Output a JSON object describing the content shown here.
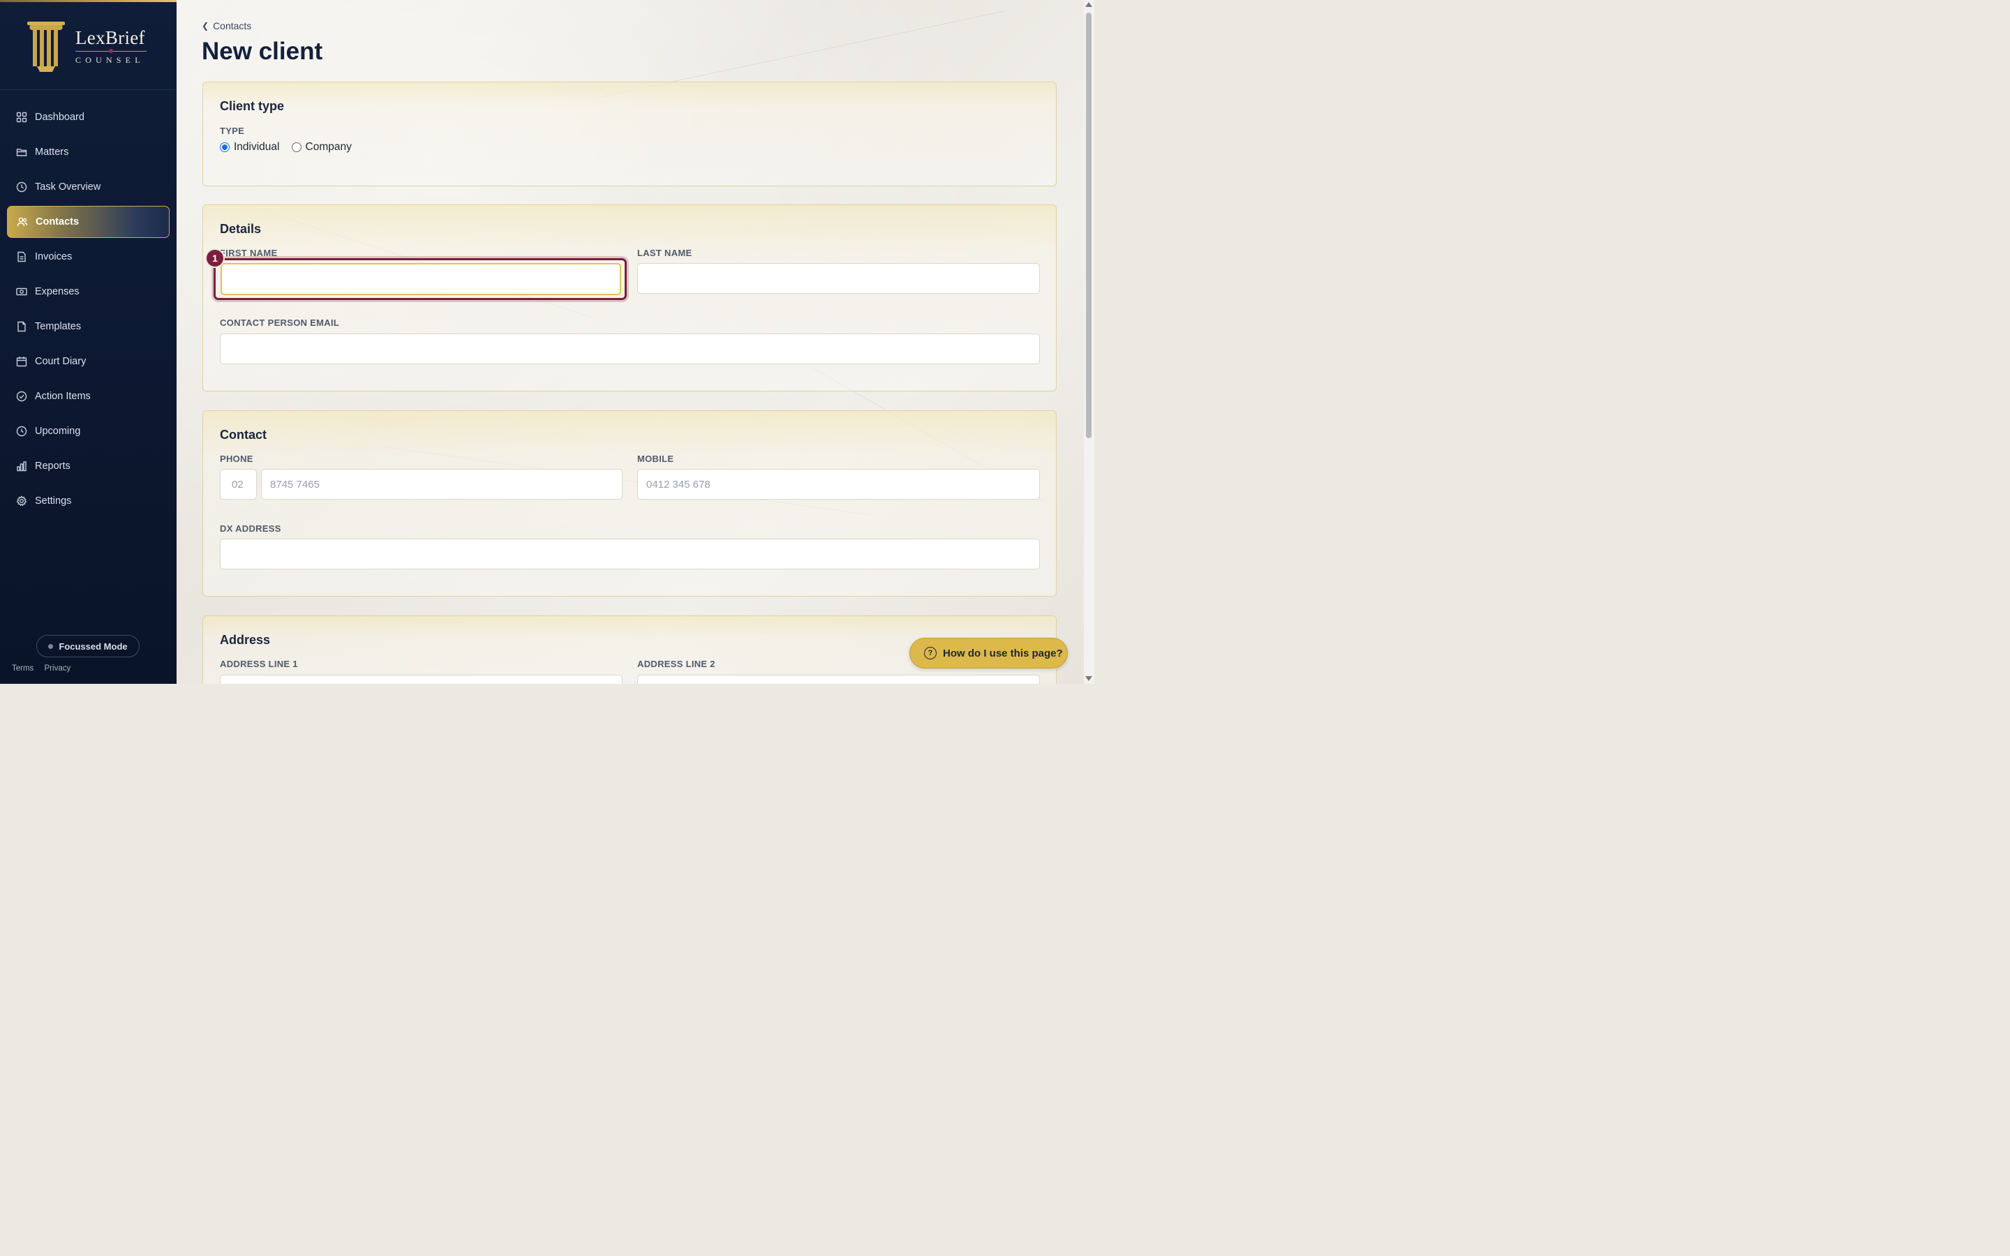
{
  "brand": {
    "name": "LexBrief",
    "subtitle": "COUNSEL",
    "logo_icon": "pillar-icon",
    "accent_color": "#c9a84a"
  },
  "sidebar": {
    "items": [
      {
        "label": "Dashboard",
        "icon": "grid-icon",
        "active": false
      },
      {
        "label": "Matters",
        "icon": "folder-icon",
        "active": false
      },
      {
        "label": "Task Overview",
        "icon": "clock-icon",
        "active": false
      },
      {
        "label": "Contacts",
        "icon": "users-icon",
        "active": true
      },
      {
        "label": "Invoices",
        "icon": "document-icon",
        "active": false
      },
      {
        "label": "Expenses",
        "icon": "banknote-icon",
        "active": false
      },
      {
        "label": "Templates",
        "icon": "file-icon",
        "active": false
      },
      {
        "label": "Court Diary",
        "icon": "calendar-icon",
        "active": false
      },
      {
        "label": "Action Items",
        "icon": "check-circle-icon",
        "active": false
      },
      {
        "label": "Upcoming",
        "icon": "clock-icon",
        "active": false
      },
      {
        "label": "Reports",
        "icon": "bar-chart-icon",
        "active": false
      },
      {
        "label": "Settings",
        "icon": "gear-icon",
        "active": false
      }
    ],
    "focus_mode_label": "Focussed Mode",
    "footer_links": [
      "Terms",
      "Privacy"
    ]
  },
  "breadcrumb": {
    "label": "Contacts"
  },
  "page_title": "New client",
  "client_type": {
    "heading": "Client type",
    "type_label": "TYPE",
    "options": [
      "Individual",
      "Company"
    ],
    "selected": "Individual"
  },
  "details": {
    "heading": "Details",
    "first_name_label": "FIRST NAME",
    "last_name_label": "LAST NAME",
    "email_label": "CONTACT PERSON EMAIL",
    "first_name_value": "",
    "last_name_value": "",
    "email_value": "",
    "focus_badge": "1"
  },
  "contact": {
    "heading": "Contact",
    "phone_label": "PHONE",
    "phone_area_placeholder": "02",
    "phone_number_placeholder": "8745 7465",
    "mobile_label": "MOBILE",
    "mobile_placeholder": "0412 345 678",
    "dx_label": "DX ADDRESS"
  },
  "address": {
    "heading": "Address",
    "line1_label": "ADDRESS LINE 1",
    "line2_label": "ADDRESS LINE 2"
  },
  "help_button": {
    "label": "How do I use this page?",
    "icon": "question-circle-icon"
  }
}
